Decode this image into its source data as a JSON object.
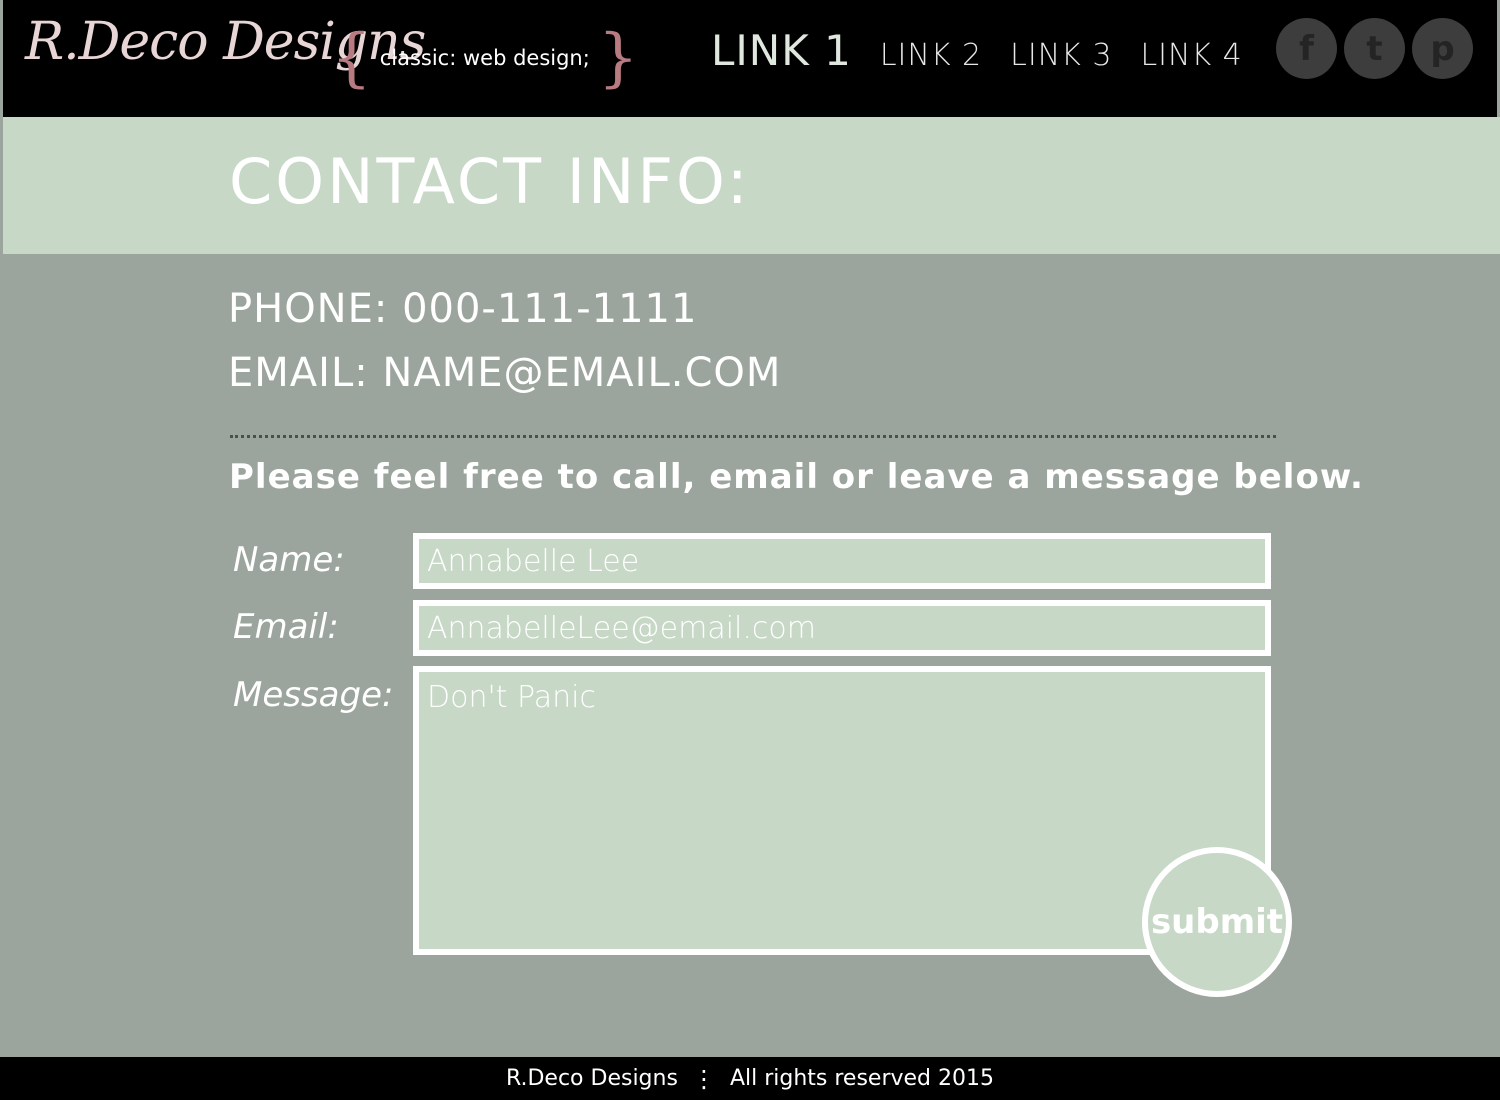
{
  "header": {
    "logo": "R.Deco Designs",
    "tagline": "classic: web design;",
    "nav": [
      "LINK 1",
      "LINK 2",
      "LINK 3",
      "LINK 4"
    ],
    "social": [
      {
        "glyph": "f",
        "icon": "facebook-icon"
      },
      {
        "glyph": "t",
        "icon": "twitter-icon"
      },
      {
        "glyph": "p",
        "icon": "pinterest-icon"
      }
    ]
  },
  "title": "CONTACT INFO:",
  "contact": {
    "phone": "PHONE: 000-111-1111",
    "email": "EMAIL: NAME@EMAIL.COM"
  },
  "intro": "Please feel free to call, email or leave a message below.",
  "form": {
    "name_label": "Name:",
    "name_placeholder": "Annabelle Lee",
    "email_label": "Email:",
    "email_placeholder": "AnnabelleLee@email.com",
    "message_label": "Message:",
    "message_placeholder": "Don't Panic",
    "submit": "submit"
  },
  "footer": {
    "brand": "R.Deco Designs",
    "separator": "⋮",
    "rights": "All rights reserved 2015"
  },
  "colors": {
    "background": "#9ca59d",
    "mint": "#c7d8c7",
    "header": "#000000",
    "logo": "#e8d6d6",
    "brace": "#b97b82"
  }
}
